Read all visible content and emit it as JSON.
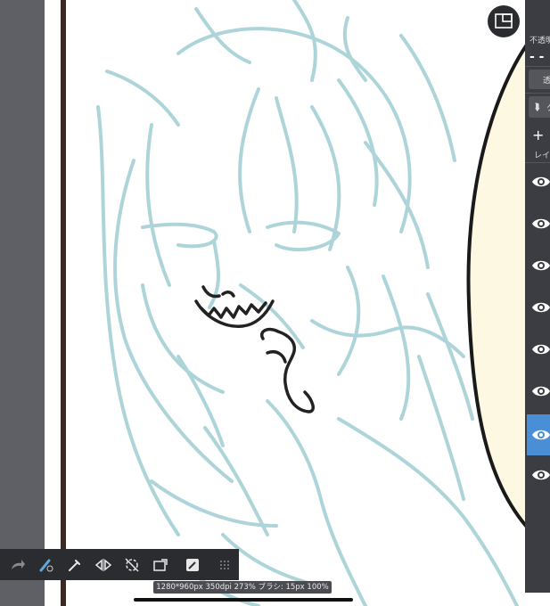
{
  "app": {
    "status_text": "1280*960px 350dpi 273% ブラシ: 15px 100%"
  },
  "layer_panel": {
    "opacity_label": "不透明",
    "opacity_value": "- -",
    "blend_label": "透",
    "folder_label": "ク",
    "add_label": "+",
    "layer_label": "レイ",
    "layers": [
      {
        "visible": true,
        "selected": false
      },
      {
        "visible": true,
        "selected": false
      },
      {
        "visible": true,
        "selected": false
      },
      {
        "visible": true,
        "selected": false
      },
      {
        "visible": true,
        "selected": false
      },
      {
        "visible": true,
        "selected": false
      },
      {
        "visible": true,
        "selected": true
      },
      {
        "visible": true,
        "selected": false
      }
    ]
  },
  "toolbar": {
    "tools": [
      "redo-icon",
      "brush-color-icon",
      "eyedropper-icon",
      "flip-horizontal-icon",
      "rotate-reset-icon",
      "eraser-icon",
      "transform-icon",
      "more-icon"
    ]
  },
  "colors": {
    "sketch_blue": "#a9d3d8",
    "ink": "#2a2a2a",
    "frame_brown": "#3b2a22",
    "bubble_fill": "#fdf8e1",
    "panel_bg": "#3c3d42",
    "selected_layer": "#4a8ed6"
  }
}
